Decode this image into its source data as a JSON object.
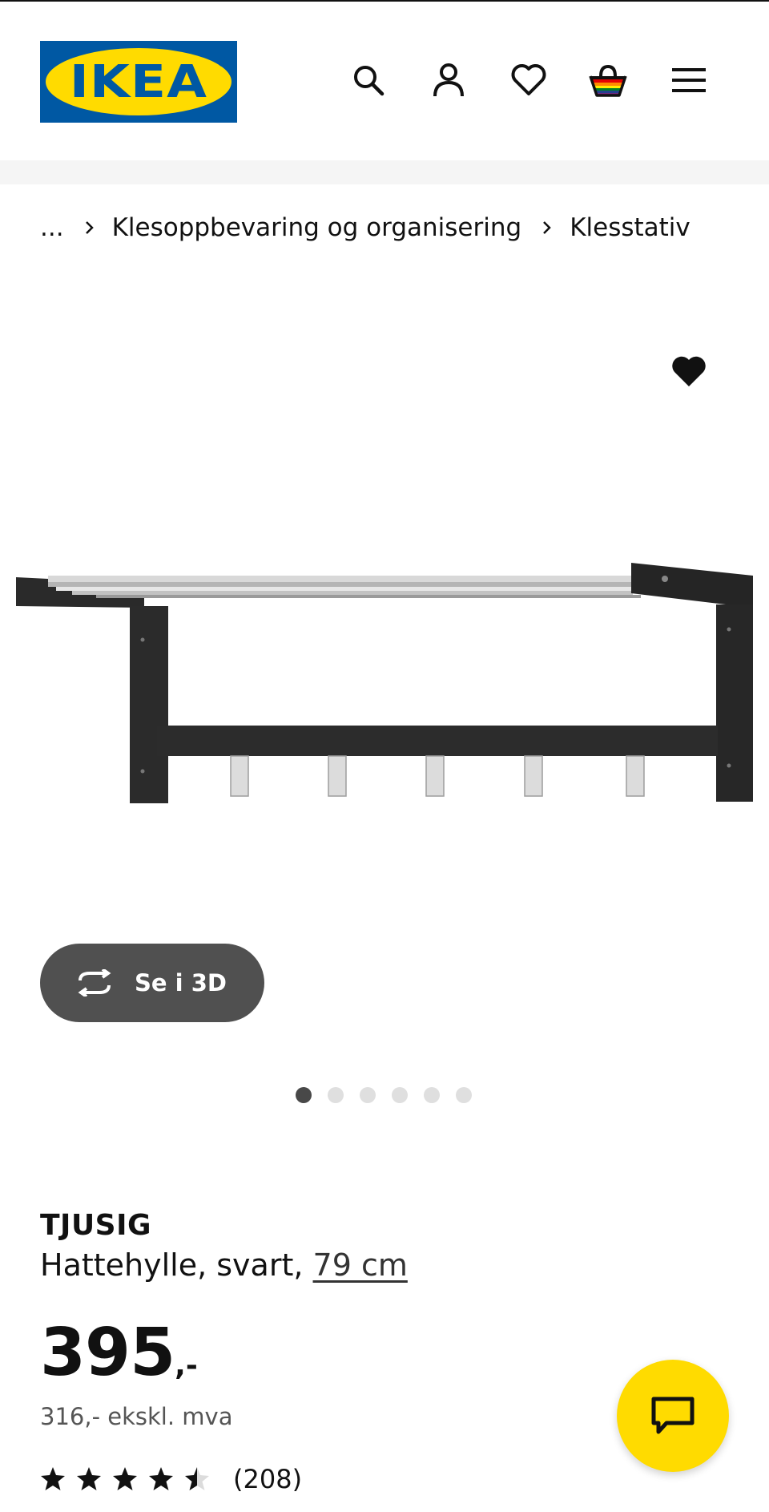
{
  "brand": {
    "logo_text": "IKEA",
    "logo_blue": "#0058a3",
    "logo_yellow": "#ffdb00"
  },
  "header": {
    "icons": [
      "search-icon",
      "account-icon",
      "heart-icon",
      "shopping-bag-icon",
      "menu-icon"
    ]
  },
  "breadcrumb": {
    "ellipsis": "...",
    "items": [
      "Klesoppbevaring og organisering",
      "Klesstativ"
    ]
  },
  "gallery": {
    "view_3d_label": "Se i 3D",
    "image_count": 6,
    "active_index": 0
  },
  "product": {
    "name": "TJUSIG",
    "description": "Hattehylle, svart, ",
    "size": "79 cm",
    "price_integer": "395",
    "price_suffix": ",-",
    "price_ex_vat": "316,- ekskl. mva",
    "rating_value": 4.5,
    "rating_max": 5,
    "review_count": "(208)"
  },
  "colors": {
    "chat_button": "#ffdb00",
    "view_3d_button": "#505050"
  }
}
